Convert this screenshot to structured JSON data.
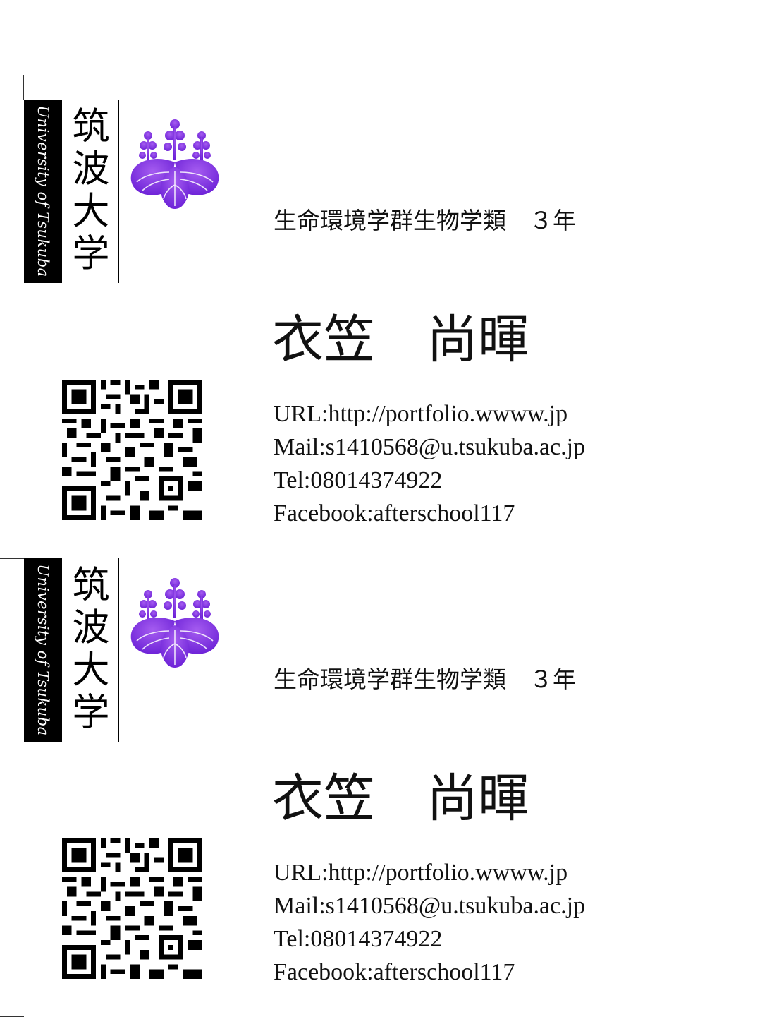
{
  "brand": {
    "logo_kanji": "筑波大学",
    "logo_english": "University of Tsukuba",
    "crest_icon": "paulownia-crest-icon",
    "crest_color": "#6a1fd6",
    "crest_color_light": "#a55cf0"
  },
  "cards": [
    {
      "affiliation": "生命環境学群生物学類　３年",
      "name": "衣笠　尚暉",
      "qr_icon": "qr-code-icon",
      "contacts": {
        "url": "URL:http://portfolio.wwww.jp",
        "mail": "Mail:s1410568@u.tsukuba.ac.jp",
        "tel": "Tel:08014374922",
        "facebook": "Facebook:afterschool117"
      }
    },
    {
      "affiliation": "生命環境学群生物学類　３年",
      "name": "衣笠　尚暉",
      "qr_icon": "qr-code-icon",
      "contacts": {
        "url": "URL:http://portfolio.wwww.jp",
        "mail": "Mail:s1410568@u.tsukuba.ac.jp",
        "tel": "Tel:08014374922",
        "facebook": "Facebook:afterschool117"
      }
    }
  ]
}
